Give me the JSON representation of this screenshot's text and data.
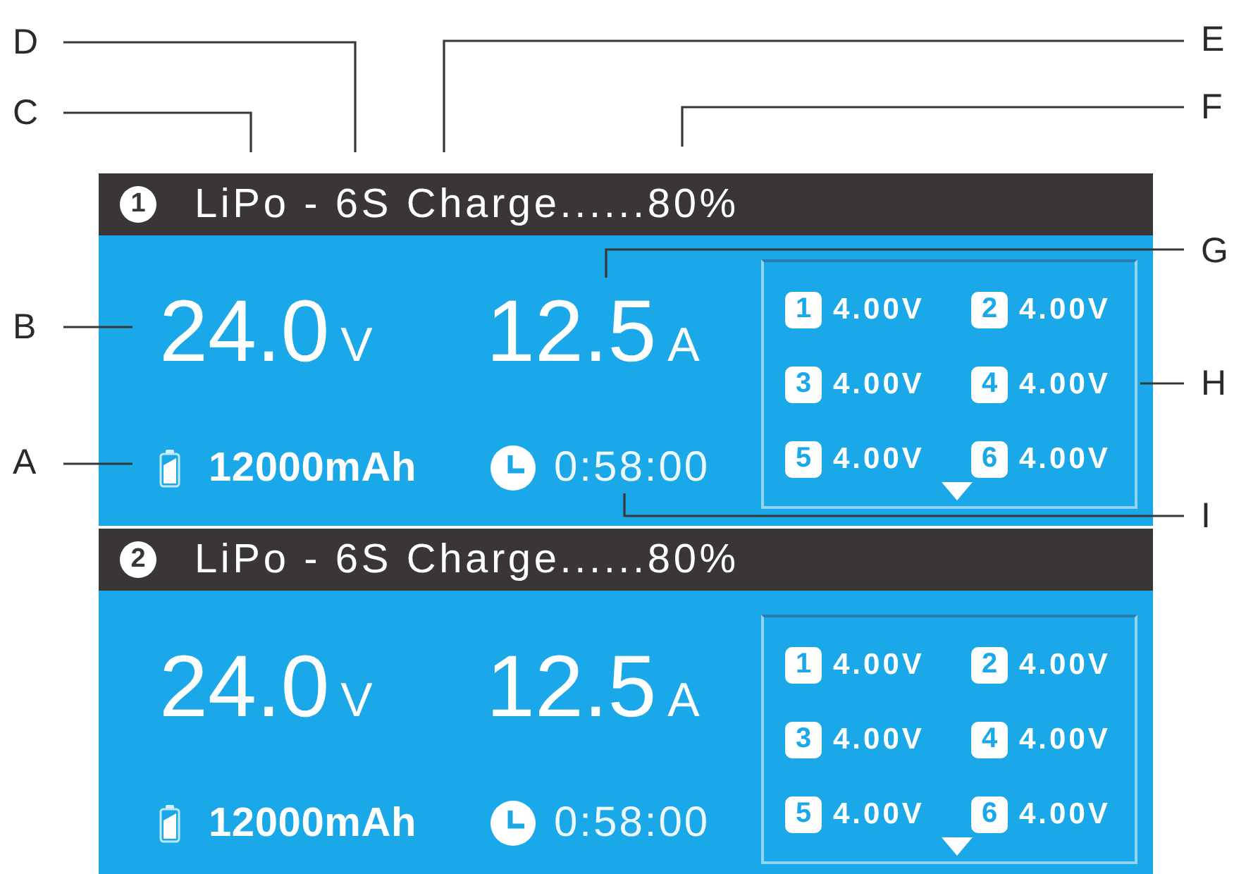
{
  "callouts_left": [
    "D",
    "C",
    "B",
    "A"
  ],
  "callouts_right": [
    "E",
    "F",
    "G",
    "H",
    "I"
  ],
  "channels": [
    {
      "number": "1",
      "status": "LiPo - 6S Charge......80%",
      "voltage": "24.0",
      "voltage_unit": "V",
      "current": "12.5",
      "current_unit": "A",
      "capacity": "12000mAh",
      "time": "0:58:00",
      "cells": [
        {
          "number": "1",
          "voltage": "4.00V"
        },
        {
          "number": "2",
          "voltage": "4.00V"
        },
        {
          "number": "3",
          "voltage": "4.00V"
        },
        {
          "number": "4",
          "voltage": "4.00V"
        },
        {
          "number": "5",
          "voltage": "4.00V"
        },
        {
          "number": "6",
          "voltage": "4.00V"
        }
      ]
    },
    {
      "number": "2",
      "status": "LiPo - 6S Charge......80%",
      "voltage": "24.0",
      "voltage_unit": "V",
      "current": "12.5",
      "current_unit": "A",
      "capacity": "12000mAh",
      "time": "0:58:00",
      "cells": [
        {
          "number": "1",
          "voltage": "4.00V"
        },
        {
          "number": "2",
          "voltage": "4.00V"
        },
        {
          "number": "3",
          "voltage": "4.00V"
        },
        {
          "number": "4",
          "voltage": "4.00V"
        },
        {
          "number": "5",
          "voltage": "4.00V"
        },
        {
          "number": "6",
          "voltage": "4.00V"
        }
      ]
    }
  ]
}
